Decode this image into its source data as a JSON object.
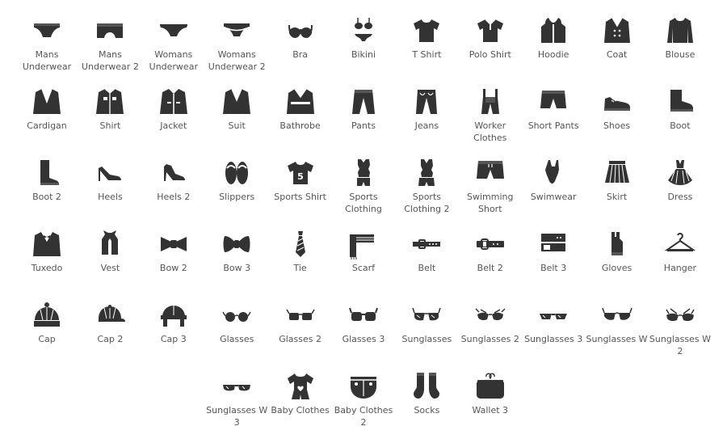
{
  "colors": {
    "icon": "#333333",
    "label": "#555555",
    "background": "#ffffff"
  },
  "rows": [
    [
      {
        "label": "Mans Underwear",
        "icon": "mans-underwear-icon"
      },
      {
        "label": "Mans Underwear 2",
        "icon": "mans-underwear-2-icon"
      },
      {
        "label": "Womans Underwear",
        "icon": "womans-underwear-icon"
      },
      {
        "label": "Womans Underwear 2",
        "icon": "womans-underwear-2-icon"
      },
      {
        "label": "Bra",
        "icon": "bra-icon"
      },
      {
        "label": "Bikini",
        "icon": "bikini-icon"
      },
      {
        "label": "T Shirt",
        "icon": "t-shirt-icon"
      },
      {
        "label": "Polo Shirt",
        "icon": "polo-shirt-icon"
      },
      {
        "label": "Hoodie",
        "icon": "hoodie-icon"
      },
      {
        "label": "Coat",
        "icon": "coat-icon"
      },
      {
        "label": "Blouse",
        "icon": "blouse-icon"
      }
    ],
    [
      {
        "label": "Cardigan",
        "icon": "cardigan-icon"
      },
      {
        "label": "Shirt",
        "icon": "shirt-icon"
      },
      {
        "label": "Jacket",
        "icon": "jacket-icon"
      },
      {
        "label": "Suit",
        "icon": "suit-icon"
      },
      {
        "label": "Bathrobe",
        "icon": "bathrobe-icon"
      },
      {
        "label": "Pants",
        "icon": "pants-icon"
      },
      {
        "label": "Jeans",
        "icon": "jeans-icon"
      },
      {
        "label": "Worker Clothes",
        "icon": "worker-clothes-icon"
      },
      {
        "label": "Short Pants",
        "icon": "short-pants-icon"
      },
      {
        "label": "Shoes",
        "icon": "shoes-icon"
      },
      {
        "label": "Boot",
        "icon": "boot-icon"
      }
    ],
    [
      {
        "label": "Boot 2",
        "icon": "boot-2-icon"
      },
      {
        "label": "Heels",
        "icon": "heels-icon"
      },
      {
        "label": "Heels 2",
        "icon": "heels-2-icon"
      },
      {
        "label": "Slippers",
        "icon": "slippers-icon"
      },
      {
        "label": "Sports Shirt",
        "icon": "sports-shirt-icon"
      },
      {
        "label": "Sports Clothing",
        "icon": "sports-clothing-icon"
      },
      {
        "label": "Sports Clothing 2",
        "icon": "sports-clothing-2-icon"
      },
      {
        "label": "Swimming Short",
        "icon": "swimming-short-icon"
      },
      {
        "label": "Swimwear",
        "icon": "swimwear-icon"
      },
      {
        "label": "Skirt",
        "icon": "skirt-icon"
      },
      {
        "label": "Dress",
        "icon": "dress-icon"
      }
    ],
    [
      {
        "label": "Tuxedo",
        "icon": "tuxedo-icon"
      },
      {
        "label": "Vest",
        "icon": "vest-icon"
      },
      {
        "label": "Bow 2",
        "icon": "bow-2-icon"
      },
      {
        "label": "Bow 3",
        "icon": "bow-3-icon"
      },
      {
        "label": "Tie",
        "icon": "tie-icon"
      },
      {
        "label": "Scarf",
        "icon": "scarf-icon"
      },
      {
        "label": "Belt",
        "icon": "belt-icon"
      },
      {
        "label": "Belt 2",
        "icon": "belt-2-icon"
      },
      {
        "label": "Belt 3",
        "icon": "belt-3-icon"
      },
      {
        "label": "Gloves",
        "icon": "gloves-icon"
      },
      {
        "label": "Hanger",
        "icon": "hanger-icon"
      }
    ],
    [
      {
        "label": "Cap",
        "icon": "cap-icon"
      },
      {
        "label": "Cap 2",
        "icon": "cap-2-icon"
      },
      {
        "label": "Cap 3",
        "icon": "cap-3-icon"
      },
      {
        "label": "Glasses",
        "icon": "glasses-icon"
      },
      {
        "label": "Glasses 2",
        "icon": "glasses-2-icon"
      },
      {
        "label": "Glasses 3",
        "icon": "glasses-3-icon"
      },
      {
        "label": "Sunglasses",
        "icon": "sunglasses-icon"
      },
      {
        "label": "Sunglasses 2",
        "icon": "sunglasses-2-icon"
      },
      {
        "label": "Sunglasses 3",
        "icon": "sunglasses-3-icon"
      },
      {
        "label": "Sunglasses W",
        "icon": "sunglasses-w-icon"
      },
      {
        "label": "Sunglasses W 2",
        "icon": "sunglasses-w-2-icon"
      }
    ],
    [
      {
        "label": "Sunglasses W 3",
        "icon": "sunglasses-w-3-icon"
      },
      {
        "label": "Baby Clothes",
        "icon": "baby-clothes-icon"
      },
      {
        "label": "Baby Clothes 2",
        "icon": "baby-clothes-2-icon"
      },
      {
        "label": "Socks",
        "icon": "socks-icon"
      },
      {
        "label": "Wallet 3",
        "icon": "wallet-3-icon"
      }
    ]
  ]
}
